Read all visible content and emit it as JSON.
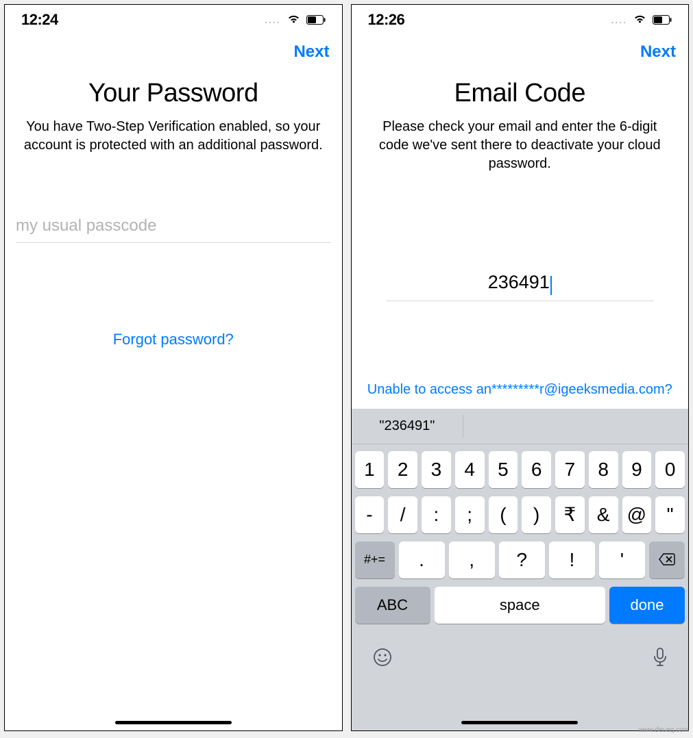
{
  "left": {
    "status": {
      "time": "12:24",
      "dots": "...."
    },
    "nav": {
      "next": "Next"
    },
    "title": "Your Password",
    "subtitle": "You have Two-Step Verification enabled, so your account is protected with an additional password.",
    "input": {
      "placeholder": "my usual passcode"
    },
    "forgot": "Forgot password?"
  },
  "right": {
    "status": {
      "time": "12:26",
      "dots": "...."
    },
    "nav": {
      "next": "Next"
    },
    "title": "Email Code",
    "subtitle": "Please check your email and enter the 6-digit code we've sent there to deactivate your cloud password.",
    "code": "236491",
    "access": "Unable to access an*********r@igeeksmedia.com?",
    "keyboard": {
      "suggestion": "\"236491\"",
      "row1": [
        "1",
        "2",
        "3",
        "4",
        "5",
        "6",
        "7",
        "8",
        "9",
        "0"
      ],
      "row2": [
        "-",
        "/",
        ":",
        ";",
        "(",
        ")",
        "₹",
        "&",
        "@",
        "\""
      ],
      "shift": "#+=",
      "row3": [
        ".",
        ",",
        "?",
        "!",
        "'"
      ],
      "abc": "ABC",
      "space": "space",
      "done": "done"
    }
  },
  "watermark": "www.deuaq.com"
}
